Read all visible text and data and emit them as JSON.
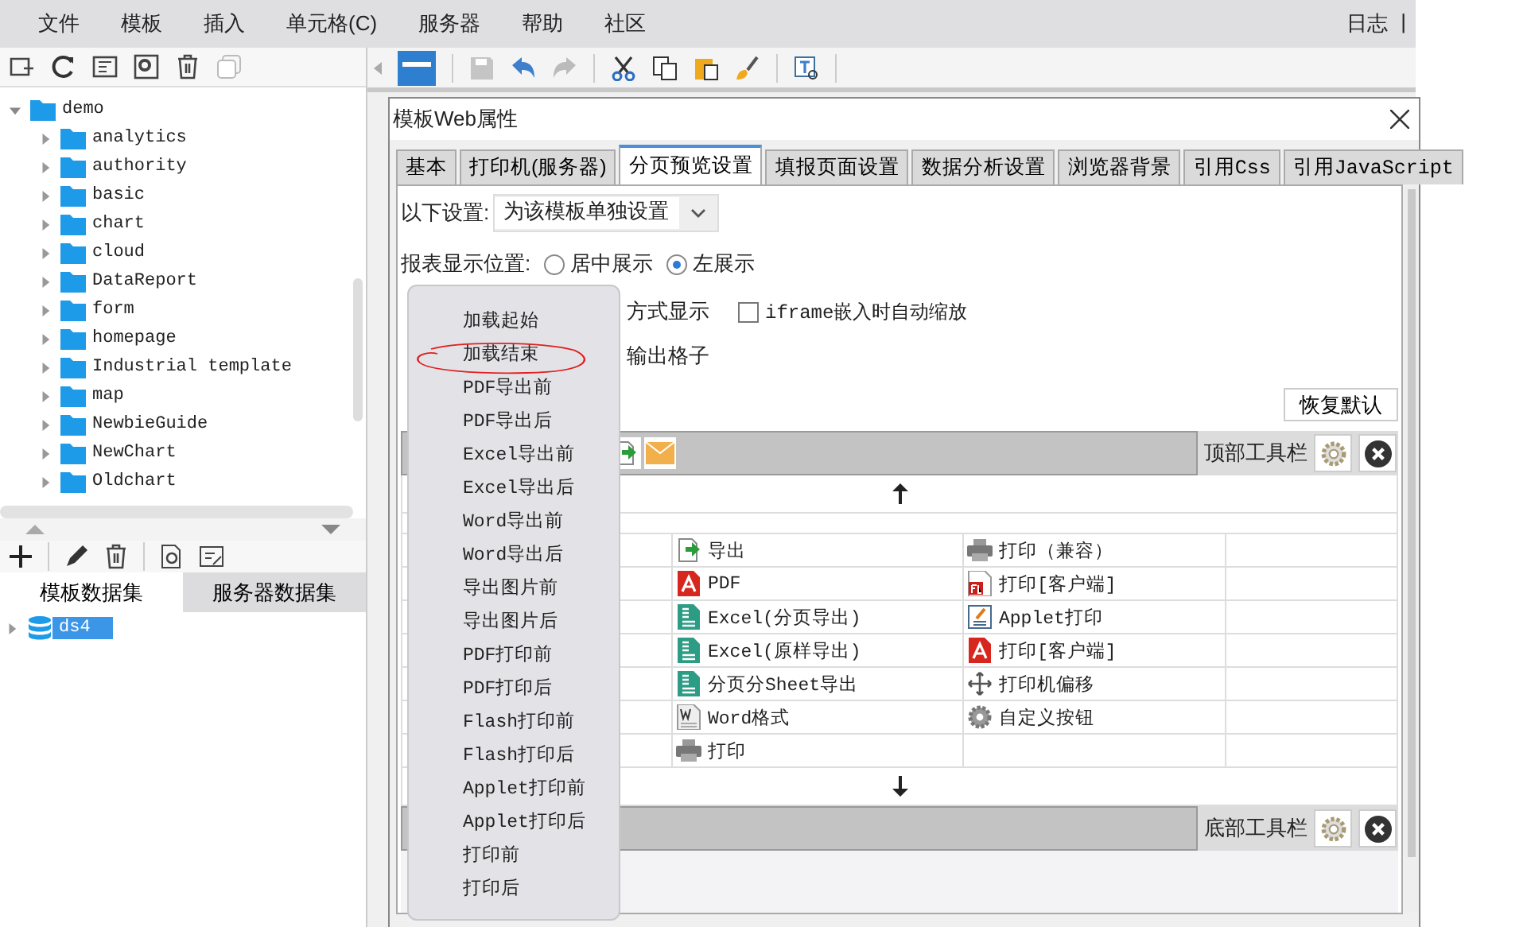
{
  "menu_bar": {
    "items": [
      "文件",
      "模板",
      "插入",
      "单元格(C)",
      "服务器",
      "帮助",
      "社区"
    ],
    "right_links": [
      "日志",
      "|"
    ]
  },
  "left_panel": {
    "tree": [
      {
        "label": "demo",
        "expanded": true,
        "children": [
          {
            "label": "analytics",
            "expanded": false
          },
          {
            "label": "authority",
            "expanded": false
          },
          {
            "label": "basic",
            "expanded": false
          },
          {
            "label": "chart",
            "expanded": false
          },
          {
            "label": "cloud",
            "expanded": false
          },
          {
            "label": "DataReport",
            "expanded": false
          },
          {
            "label": "form",
            "expanded": false
          },
          {
            "label": "homepage",
            "expanded": false
          },
          {
            "label": "Industrial template",
            "expanded": false
          },
          {
            "label": "map",
            "expanded": false
          },
          {
            "label": "NewbieGuide",
            "expanded": false
          },
          {
            "label": "NewChart",
            "expanded": false
          },
          {
            "label": "Oldchart",
            "expanded": false
          }
        ]
      }
    ],
    "dataset_tabs": [
      {
        "label": "模板数据集",
        "selected": true
      },
      {
        "label": "服务器数据集",
        "selected": false
      }
    ],
    "datasets": [
      {
        "label": "ds4",
        "selected": true
      }
    ]
  },
  "dialog": {
    "title": "模板Web属性",
    "tabs": [
      {
        "label": "基本",
        "selected": false
      },
      {
        "label": "打印机(服务器)",
        "selected": false
      },
      {
        "label": "分页预览设置",
        "selected": true
      },
      {
        "label": "填报页面设置",
        "selected": false
      },
      {
        "label": "数据分析设置",
        "selected": false
      },
      {
        "label": "浏览器背景",
        "selected": false
      },
      {
        "label": "引用Css",
        "selected": false
      },
      {
        "label": "引用JavaScript",
        "selected": false
      }
    ],
    "settings_label": "以下设置:",
    "settings_value": "为该模板单独设置",
    "position_label": "报表显示位置:",
    "position_options": [
      {
        "label": "居中展示",
        "selected": false
      },
      {
        "label": "左展示",
        "selected": true
      }
    ],
    "partial_text_1": "方式显示",
    "iframe_option": {
      "label": "iframe嵌入时自动缩放",
      "checked": false
    },
    "partial_text_2": "输出格子",
    "reset_button": "恢复默认",
    "top_toolbar_label": "顶部工具栏",
    "bottom_toolbar_label": "底部工具栏",
    "button_rows": [
      {
        "cells": [
          {
            "label": "导出",
            "kind": "export"
          },
          {
            "label": "打印（兼容）",
            "kind": "print"
          }
        ]
      },
      {
        "cells": [
          {
            "label": "PDF",
            "kind": "pdf"
          },
          {
            "label": "打印[客户端]",
            "kind": "flash"
          }
        ]
      },
      {
        "cells": [
          {
            "label": "Excel(分页导出)",
            "kind": "excel"
          },
          {
            "label": "Applet打印",
            "kind": "applet"
          }
        ]
      },
      {
        "cells": [
          {
            "label": "Excel(原样导出)",
            "kind": "excel"
          },
          {
            "label": "打印[客户端]",
            "kind": "pdf"
          }
        ]
      },
      {
        "cells": [
          {
            "label": "分页分Sheet导出",
            "kind": "excel"
          },
          {
            "label": "打印机偏移",
            "kind": "move"
          }
        ]
      },
      {
        "cells": [
          {
            "label": "Word格式",
            "kind": "word"
          },
          {
            "label": "自定义按钮",
            "kind": "gear"
          }
        ]
      },
      {
        "cells": [
          {
            "label": "打印",
            "kind": "print"
          }
        ]
      }
    ],
    "event_menu": [
      "加载起始",
      "加载结束",
      "PDF导出前",
      "PDF导出后",
      "Excel导出前",
      "Excel导出后",
      "Word导出前",
      "Word导出后",
      "导出图片前",
      "导出图片后",
      "PDF打印前",
      "PDF打印后",
      "Flash打印前",
      "Flash打印后",
      "Applet打印前",
      "Applet打印后",
      "打印前",
      "打印后"
    ]
  }
}
